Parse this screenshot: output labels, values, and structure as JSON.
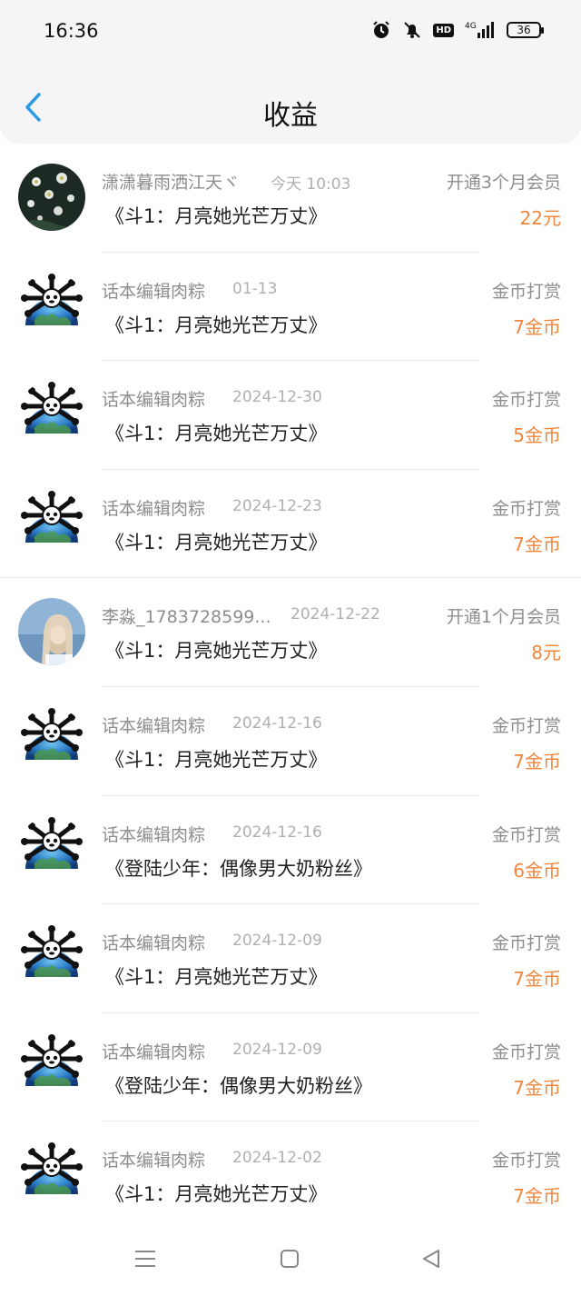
{
  "status_bar": {
    "time": "16:36",
    "hd": "HD",
    "network": "4G",
    "battery": "36",
    "icons": [
      "alarm-icon",
      "mute-bell-icon",
      "hd-icon",
      "signal-icon",
      "battery-icon"
    ]
  },
  "header": {
    "title": "收益",
    "back_icon": "chevron-left-icon",
    "accent_color": "#2d9be6"
  },
  "colors": {
    "amount": "#f0863c",
    "secondary_text": "#8d8d8d",
    "date_text": "#b0b0b0"
  },
  "records": [
    {
      "user": "潇潇暮雨洒江天ヾ",
      "date": "今天 10:03",
      "type": "开通3个月会员",
      "book": "《斗1：月亮她光芒万丈》",
      "amount": "22元",
      "avatar": "flowers-photo"
    },
    {
      "user": "话本编辑肉粽",
      "date": "01-13",
      "type": "金币打赏",
      "book": "《斗1：月亮她光芒万丈》",
      "amount": "7金币",
      "avatar": "panda-earth"
    },
    {
      "user": "话本编辑肉粽",
      "date": "2024-12-30",
      "type": "金币打赏",
      "book": "《斗1：月亮她光芒万丈》",
      "amount": "5金币",
      "avatar": "panda-earth"
    },
    {
      "user": "话本编辑肉粽",
      "date": "2024-12-23",
      "type": "金币打赏",
      "book": "《斗1：月亮她光芒万丈》",
      "amount": "7金币",
      "avatar": "panda-earth"
    },
    {
      "user": "李淼_1783728599...",
      "date": "2024-12-22",
      "type": "开通1个月会员",
      "book": "《斗1：月亮她光芒万丈》",
      "amount": "8元",
      "avatar": "girl-photo"
    },
    {
      "user": "话本编辑肉粽",
      "date": "2024-12-16",
      "type": "金币打赏",
      "book": "《斗1：月亮她光芒万丈》",
      "amount": "7金币",
      "avatar": "panda-earth"
    },
    {
      "user": "话本编辑肉粽",
      "date": "2024-12-16",
      "type": "金币打赏",
      "book": "《登陆少年：偶像男大奶粉丝》",
      "amount": "6金币",
      "avatar": "panda-earth"
    },
    {
      "user": "话本编辑肉粽",
      "date": "2024-12-09",
      "type": "金币打赏",
      "book": "《斗1：月亮她光芒万丈》",
      "amount": "7金币",
      "avatar": "panda-earth"
    },
    {
      "user": "话本编辑肉粽",
      "date": "2024-12-09",
      "type": "金币打赏",
      "book": "《登陆少年：偶像男大奶粉丝》",
      "amount": "7金币",
      "avatar": "panda-earth"
    },
    {
      "user": "话本编辑肉粽",
      "date": "2024-12-02",
      "type": "金币打赏",
      "book": "《斗1：月亮她光芒万丈》",
      "amount": "7金币",
      "avatar": "panda-earth"
    }
  ],
  "system_nav": {
    "icons": [
      "menu-icon",
      "home-square-icon",
      "back-triangle-icon"
    ]
  }
}
